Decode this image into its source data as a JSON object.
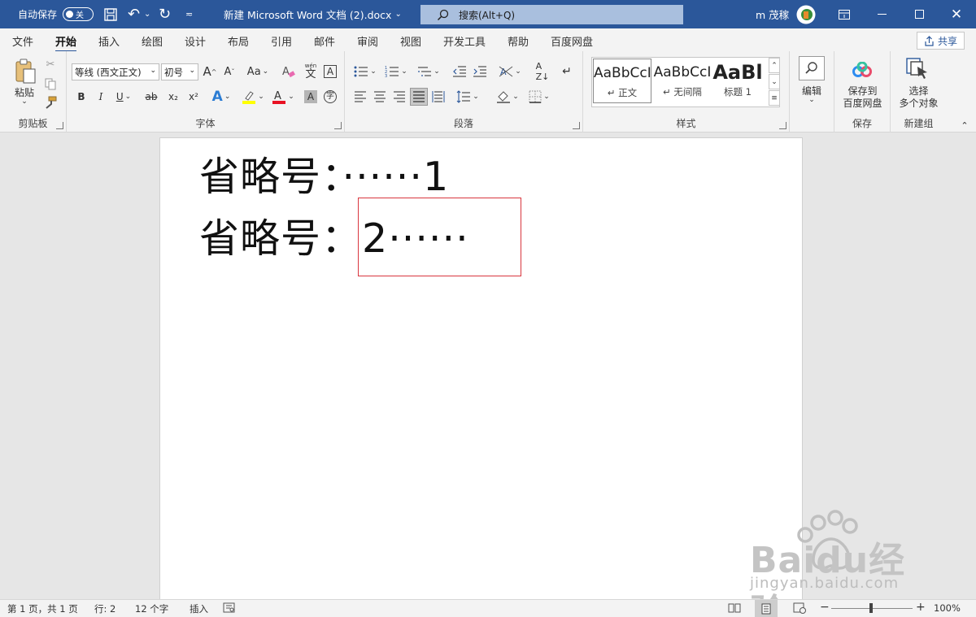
{
  "titlebar": {
    "autosave_label": "自动保存",
    "autosave_state": "关",
    "doc_title": "新建 Microsoft Word 文档 (2).docx",
    "search_placeholder": "搜索(Alt+Q)",
    "user_name": "m 茂稼"
  },
  "tabs": [
    "文件",
    "开始",
    "插入",
    "绘图",
    "设计",
    "布局",
    "引用",
    "邮件",
    "审阅",
    "视图",
    "开发工具",
    "帮助",
    "百度网盘"
  ],
  "active_tab": "开始",
  "share_label": "共享",
  "ribbon": {
    "clipboard": {
      "paste_label": "粘贴",
      "group_label": "剪贴板"
    },
    "font": {
      "font_name": "等线 (西文正文)",
      "font_size": "初号",
      "grow": "A",
      "shrink": "A",
      "case": "Aa",
      "phonetic": "wén",
      "bold": "B",
      "italic": "I",
      "underline": "U",
      "strike": "ab",
      "sub": "x₂",
      "sup": "x²",
      "group_label": "字体"
    },
    "paragraph": {
      "group_label": "段落"
    },
    "styles": {
      "items": [
        {
          "preview": "AaBbCcI",
          "name": "↵ 正文"
        },
        {
          "preview": "AaBbCcI",
          "name": "↵ 无间隔"
        },
        {
          "preview": "AaBl",
          "name": "标题 1"
        }
      ],
      "group_label": "样式"
    },
    "editing": {
      "label": "编辑"
    },
    "save": {
      "label_line1": "保存到",
      "label_line2": "百度网盘",
      "group_label": "保存"
    },
    "newgroup": {
      "label_line1": "选择",
      "label_line2": "多个对象",
      "group_label": "新建组"
    }
  },
  "document": {
    "line1": "省略号：······1",
    "line2_prefix": "省略号：",
    "line2_boxed": "2······"
  },
  "statusbar": {
    "page": "第 1 页，共 1 页",
    "line": "行: 2",
    "words": "12 个字",
    "mode": "插入",
    "zoom": "100%"
  },
  "watermark": {
    "brand": "Baidu经验",
    "url": "jingyan.baidu.com"
  },
  "colors": {
    "accent": "#2b579a",
    "highlight": "#ffff00",
    "font_color": "#e81123",
    "box": "#d9363e"
  }
}
